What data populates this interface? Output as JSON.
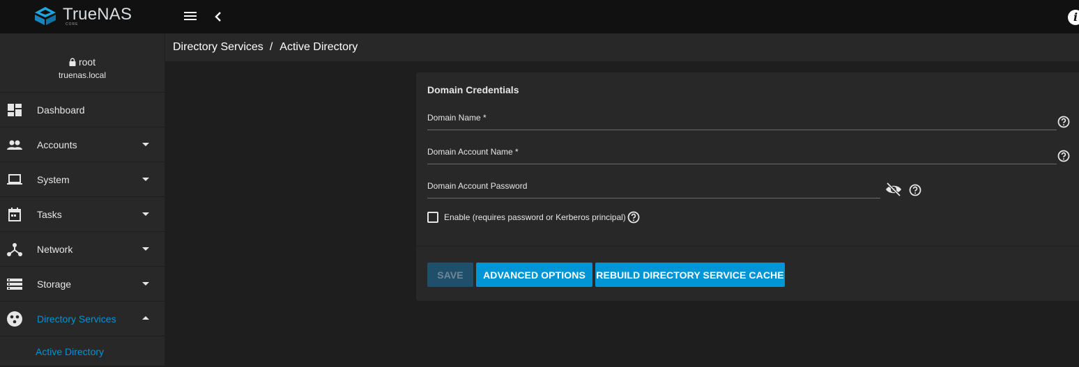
{
  "app": {
    "logo_text": "TrueNAS",
    "logo_sub": "CORE"
  },
  "topbar": {
    "info_label": "i"
  },
  "user": {
    "name": "root",
    "host": "truenas.local"
  },
  "sidebar": {
    "items": [
      {
        "label": "Dashboard",
        "icon": "dashboard-icon"
      },
      {
        "label": "Accounts",
        "icon": "people-icon"
      },
      {
        "label": "System",
        "icon": "laptop-icon"
      },
      {
        "label": "Tasks",
        "icon": "calendar-icon"
      },
      {
        "label": "Network",
        "icon": "network-icon"
      },
      {
        "label": "Storage",
        "icon": "storage-icon"
      },
      {
        "label": "Directory Services",
        "icon": "directory-icon"
      }
    ],
    "sub_item": "Active Directory"
  },
  "breadcrumb": {
    "parent": "Directory Services",
    "separator": "/",
    "current": "Active Directory"
  },
  "form": {
    "title": "Domain Credentials",
    "domain_name_label": "Domain Name *",
    "domain_name_value": "",
    "account_name_label": "Domain Account Name *",
    "account_name_value": "",
    "password_label": "Domain Account Password",
    "password_value": "",
    "enable_label": "Enable (requires password or Kerberos principal)",
    "enable_checked": false
  },
  "buttons": {
    "save": "SAVE",
    "advanced": "ADVANCED OPTIONS",
    "rebuild": "REBUILD DIRECTORY SERVICE CACHE"
  },
  "colors": {
    "accent": "#0095d5",
    "topbar": "#111111",
    "panel": "#282828",
    "background": "#1e1e1e"
  }
}
